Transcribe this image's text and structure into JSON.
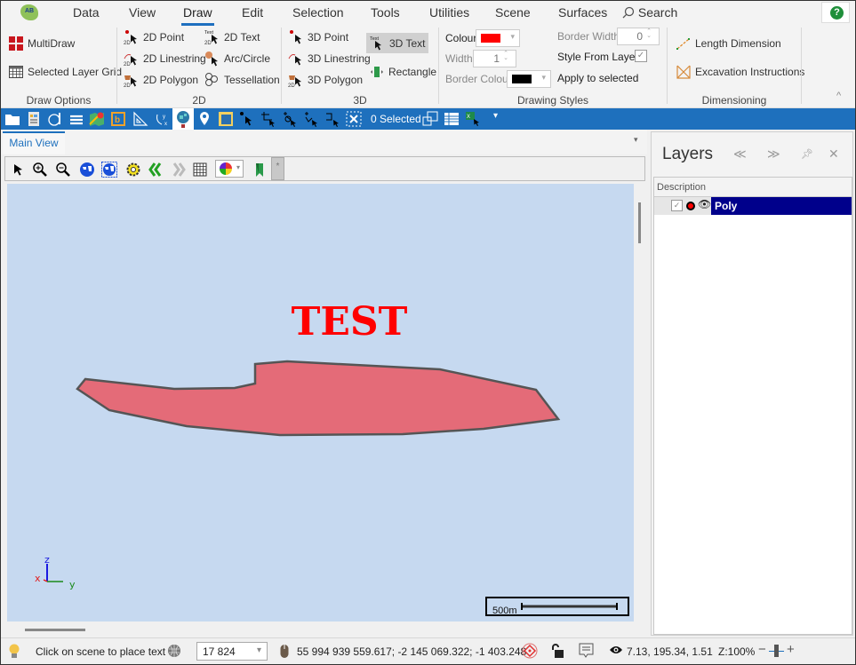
{
  "app": {
    "logo_text": "AB",
    "menu": [
      "Data",
      "View",
      "Draw",
      "Edit",
      "Selection",
      "Tools",
      "Utilities",
      "Scene",
      "Surfaces"
    ],
    "active_menu": "Draw",
    "search_label": "Search",
    "help_label": "?"
  },
  "ribbon": {
    "draw_options": {
      "label": "Draw Options",
      "multidraw": "MultiDraw",
      "selected_layer_grid": "Selected Layer Grid"
    },
    "group_2d": {
      "label": "2D",
      "point": "2D Point",
      "linestring": "2D Linestring",
      "polygon": "2D Polygon",
      "text": "2D Text",
      "arc": "Arc/Circle",
      "tessellation": "Tessellation"
    },
    "group_3d": {
      "label": "3D",
      "point": "3D Point",
      "linestring": "3D Linestring",
      "polygon": "3D Polygon",
      "text": "3D Text",
      "rectangle": "Rectangle"
    },
    "drawing_styles": {
      "label": "Drawing Styles",
      "colour_label": "Colour",
      "colour_value": "#ff0000",
      "width_label": "Width",
      "width_value": "1",
      "border_colour_label": "Border Colour",
      "border_colour_value": "#000000",
      "border_width_label": "Border Width",
      "border_width_value": "0",
      "style_from_layer_label": "Style From Layer",
      "style_from_layer_checked": true,
      "apply_label": "Apply to selected"
    },
    "dimensioning": {
      "label": "Dimensioning",
      "length": "Length Dimension",
      "excavation": "Excavation Instructions"
    }
  },
  "toolbar": {
    "selected_count": "0 Selected"
  },
  "main_view": {
    "tab_label": "Main View",
    "pin_label": "*",
    "scene": {
      "background": "#c6d9f0",
      "text_label": "TEST",
      "text_color": "#ff0000",
      "polygon_fill": "#e46b78",
      "polygon_stroke": "#555555",
      "scale_label": "500m",
      "axis": {
        "x": "x",
        "y": "y",
        "z": "z"
      }
    }
  },
  "layers": {
    "title": "Layers",
    "column_header": "Description",
    "rows": [
      {
        "name": "Poly",
        "checked": true,
        "color": "#ff0000",
        "visible": true
      }
    ]
  },
  "status": {
    "hint": "Click on scene to place text",
    "scale_value": "17 824",
    "cursor_coords": "55 994 939 559.617; -2 145 069.322; -1 403.248",
    "camera": "7.13, 195.34, 1.51",
    "zoom": "Z:100%"
  }
}
